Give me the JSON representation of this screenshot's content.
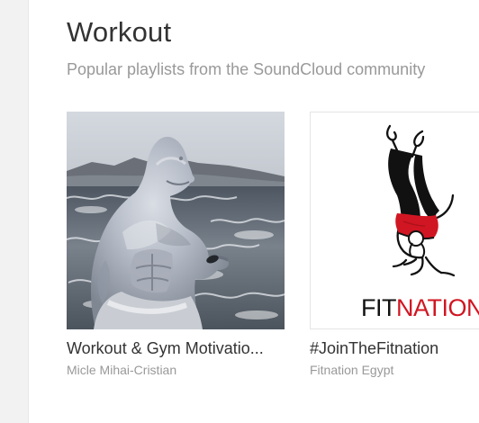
{
  "section": {
    "title": "Workout",
    "subtitle": "Popular playlists from the SoundCloud community"
  },
  "playlists": [
    {
      "title": "Workout & Gym Motivatio...",
      "user": "Micle Mihai-Cristian",
      "artwork_name": "alien-figure-sea-artwork"
    },
    {
      "title": "#JoinTheFitnation",
      "user": "Fitnation Egypt",
      "artwork_name": "fitnation-handstand-logo",
      "logo_text_black": "FIT",
      "logo_text_red": "NATION"
    }
  ],
  "colors": {
    "heading": "#333333",
    "muted": "#999999",
    "background": "#ffffff",
    "gutter": "#f2f2f2",
    "brand_red": "#d01622"
  }
}
